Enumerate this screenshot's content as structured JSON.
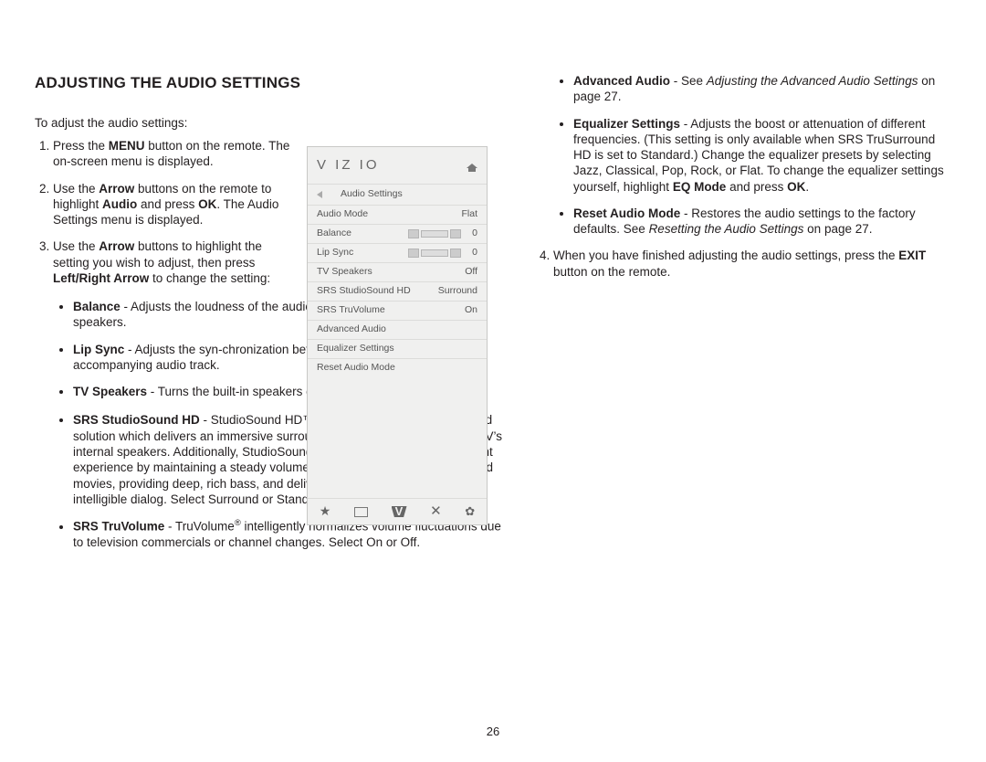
{
  "page_number": "26",
  "title": "ADJUSTING THE AUDIO SETTINGS",
  "intro": "To adjust the audio settings:",
  "step1": {
    "pre": "Press the ",
    "bold": "MENU",
    "post": " button on the remote. The on-screen menu is displayed."
  },
  "step2": {
    "a": "Use the ",
    "b": "Arrow",
    "c": " buttons on the remote to highlight ",
    "d": "Audio",
    "e": " and press ",
    "f": "OK",
    "g": ". The Audio Settings menu is displayed."
  },
  "step3": {
    "a": "Use the ",
    "b": "Arrow",
    "c": " buttons to highlight the setting you wish to adjust, then press ",
    "d": "Left/Right Arrow",
    "e": " to change the setting:"
  },
  "bullets_left": {
    "balance": {
      "name": "Balance",
      "text": " - Adjusts the loudness of the audio output from the left and right speakers."
    },
    "lipsync": {
      "name": "Lip Sync",
      "text": " - Adjusts the syn-chronization between the display image and the accompanying audio track."
    },
    "tvspk": {
      "name": "TV Speakers",
      "text": " - Turns the built-in speakers on or off."
    },
    "srshd": {
      "name": "SRS StudioSound HD",
      "text": " - StudioSound HD™ is a feature-rich surround sound solution which delivers an immersive surround sound experience from the TV’s internal speakers. Additionally, StudioSound HD completes the entertainment experience by maintaining a steady volume while watching programming and movies, providing deep, rich bass, and delivering crisp details and clear, intelligible dialog. Select Surround or Standard."
    },
    "truvol": {
      "name": "SRS TruVolume",
      "super": "®",
      "text": " intelligently normalizes volume fluctuations due to television commercials or channel changes. Select On or Off."
    }
  },
  "bullets_right": {
    "advaudio": {
      "name": "Advanced Audio",
      "see": " - See ",
      "ital": "Adjusting the Advanced Audio Settings",
      "rest": " on page 27."
    },
    "eq": {
      "name": "Equalizer Settings",
      "text1": " - Adjusts the boost or attenuation of different frequencies. (This setting is only available when SRS TruSurround HD is set to Standard.) Change the equalizer presets by selecting Jazz, Classical, Pop, Rock, or Flat. To change the equalizer settings yourself, highlight ",
      "eqmode": "EQ Mode",
      "and": " and press ",
      "ok": "OK",
      "dot": "."
    },
    "reset": {
      "name": "Reset Audio Mode",
      "text1": " - Restores the audio settings to the factory defaults. See ",
      "ital": "Resetting the Audio Settings",
      "rest": " on page 27."
    }
  },
  "step4": {
    "a": "When you have finished adjusting the audio settings, press the ",
    "b": "EXIT",
    "c": " button on the remote."
  },
  "tv": {
    "logo": "V IZ IO",
    "crumb": "Audio Settings",
    "rows": [
      {
        "label": "Audio Mode",
        "value": "Flat",
        "type": "text"
      },
      {
        "label": "Balance",
        "value": "0",
        "type": "slider"
      },
      {
        "label": "Lip Sync",
        "value": "0",
        "type": "slider"
      },
      {
        "label": "TV Speakers",
        "value": "Off",
        "type": "text"
      },
      {
        "label": "SRS StudioSound HD",
        "value": "Surround",
        "type": "text"
      },
      {
        "label": "SRS TruVolume",
        "value": "On",
        "type": "text"
      },
      {
        "label": "Advanced Audio",
        "value": "",
        "type": "text"
      },
      {
        "label": "Equalizer Settings",
        "value": "",
        "type": "text"
      },
      {
        "label": "Reset Audio Mode",
        "value": "",
        "type": "text"
      }
    ],
    "star": "★"
  }
}
